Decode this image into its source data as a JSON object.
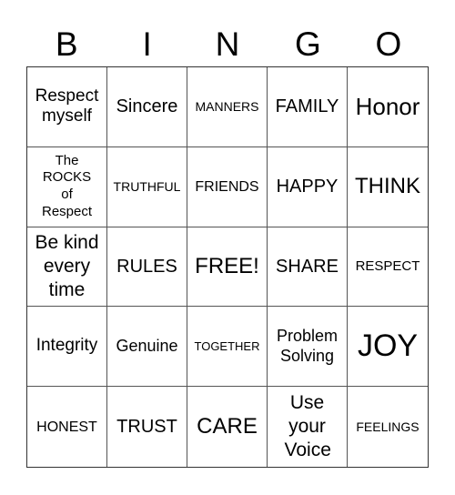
{
  "header": [
    "B",
    "I",
    "N",
    "G",
    "O"
  ],
  "cells": [
    [
      "Respect myself",
      "Sincere",
      "MANNERS",
      "FAMILY",
      "Honor"
    ],
    [
      "The ROCKS of Respect",
      "TRUTHFUL",
      "FRIENDS",
      "HAPPY",
      "THINK"
    ],
    [
      "Be kind every time",
      "RULES",
      "FREE!",
      "SHARE",
      "RESPECT"
    ],
    [
      "Integrity",
      "Genuine",
      "TOGETHER",
      "Problem Solving",
      "JOY"
    ],
    [
      "HONEST",
      "TRUST",
      "CARE",
      "Use your Voice",
      "FEELINGS"
    ]
  ]
}
